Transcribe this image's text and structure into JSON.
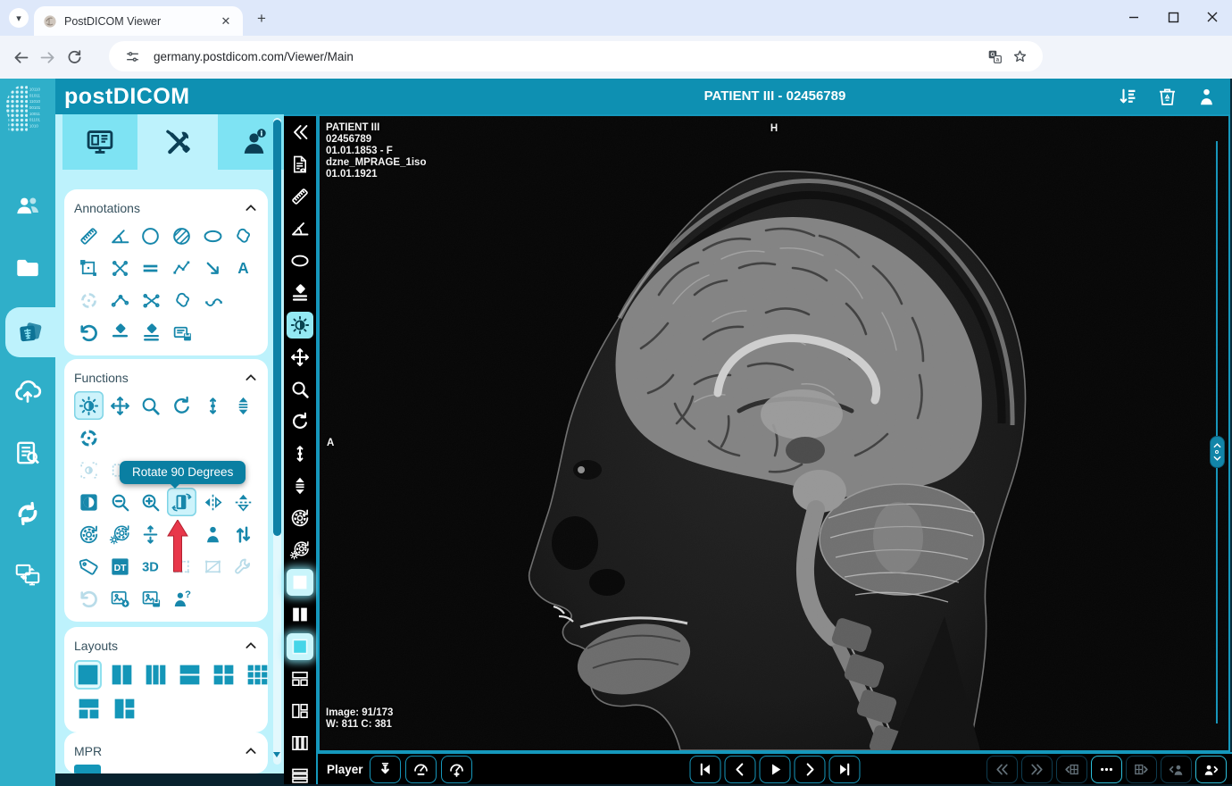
{
  "browser": {
    "tab_title": "PostDICOM Viewer",
    "url": "germany.postdicom.com/Viewer/Main"
  },
  "header": {
    "logo_post": "post",
    "logo_dicom": "DICOM",
    "title": "PATIENT III - 02456789",
    "icons": [
      {
        "name": "sort-queue-icon",
        "sym": "s-sortdown",
        "inter": "true"
      },
      {
        "name": "recycle-bin-icon",
        "sym": "s-trash",
        "inter": "true"
      },
      {
        "name": "account-icon",
        "sym": "s-person",
        "inter": "true"
      }
    ]
  },
  "sidebar": {
    "items": [
      {
        "name": "sidebar-item-patient-search",
        "sym": "s-users",
        "st": "",
        "inter": "true"
      },
      {
        "name": "sidebar-item-folders",
        "sym": "s-folder",
        "st": "",
        "inter": "true"
      },
      {
        "name": "sidebar-item-viewer",
        "sym": "s-xray",
        "st": "active",
        "inter": "true"
      },
      {
        "name": "sidebar-item-upload",
        "sym": "s-cloudup",
        "st": "",
        "inter": "true"
      },
      {
        "name": "sidebar-item-order-worklist",
        "sym": "s-listsearch",
        "st": "",
        "inter": "true"
      },
      {
        "name": "sidebar-item-dicom-transfer",
        "sym": "s-sync",
        "st": "",
        "inter": "true"
      },
      {
        "name": "sidebar-item-remote-viewing",
        "sym": "s-screens",
        "st": "",
        "inter": "true"
      }
    ]
  },
  "panel": {
    "tabs": [
      {
        "name": "tab-study-content",
        "sym": "s-monitor",
        "st": "",
        "inter": "true"
      },
      {
        "name": "tab-tools",
        "sym": "s-tools",
        "st": "selected",
        "inter": "true"
      },
      {
        "name": "tab-patient-info",
        "sym": "s-personinfo",
        "st": "",
        "inter": "true"
      }
    ],
    "tooltip": "Rotate 90 Degrees",
    "annotations": {
      "title": "Annotations",
      "r1": [
        {
          "name": "measure-length-tool",
          "sym": "s-ruler",
          "st": "",
          "inter": "true"
        },
        {
          "name": "measure-angle-tool",
          "sym": "s-angle",
          "st": "",
          "inter": "true"
        },
        {
          "name": "circle-roi-tool",
          "sym": "s-circle",
          "st": "",
          "inter": "true"
        },
        {
          "name": "filled-circle-roi-tool",
          "sym": "s-circlehatch",
          "st": "",
          "inter": "true"
        },
        {
          "name": "ellipse-roi-tool",
          "sym": "s-ellipse",
          "st": "",
          "inter": "true"
        },
        {
          "name": "freehand-roi-tool",
          "sym": "s-blob",
          "st": "",
          "inter": "true"
        }
      ],
      "r2": [
        {
          "name": "rectangle-roi-tool",
          "sym": "s-rectroi",
          "st": "",
          "inter": "true"
        },
        {
          "name": "cross-measurement-tool",
          "sym": "s-crossx",
          "st": "",
          "inter": "true"
        },
        {
          "name": "parallel-lines-tool",
          "sym": "s-parallel",
          "st": "",
          "inter": "true"
        },
        {
          "name": "polyline-tool",
          "sym": "s-polyline",
          "st": "",
          "inter": "true"
        },
        {
          "name": "arrow-annotation-tool",
          "sym": "s-arrowse",
          "st": "",
          "inter": "true"
        },
        {
          "name": "text-annotation-tool",
          "sym": "s-texta",
          "st": "",
          "inter": "true"
        }
      ],
      "r3": [
        {
          "name": "localizer-point-tool",
          "sym": "s-target",
          "st": "disabled",
          "inter": "false"
        },
        {
          "name": "open-angle-tool",
          "sym": "s-anglenodes",
          "st": "",
          "inter": "true"
        },
        {
          "name": "cobb-angle-tool",
          "sym": "s-xnodes",
          "st": "",
          "inter": "true"
        },
        {
          "name": "closed-freehand-tool",
          "sym": "s-blob",
          "st": "",
          "inter": "true"
        },
        {
          "name": "spline-curve-tool",
          "sym": "s-spline",
          "st": "",
          "inter": "true"
        }
      ],
      "r4": [
        {
          "name": "undo-annotation-button",
          "sym": "s-undo",
          "st": "",
          "inter": "true"
        },
        {
          "name": "erase-annotation-button",
          "sym": "s-eraser",
          "st": "",
          "inter": "true"
        },
        {
          "name": "erase-all-annotations-button",
          "sym": "s-eraserline",
          "st": "",
          "inter": "true"
        },
        {
          "name": "save-annotations-button",
          "sym": "s-savenote",
          "st": "",
          "inter": "true"
        }
      ]
    },
    "functions": {
      "title": "Functions",
      "r1": [
        {
          "name": "window-level-tool",
          "sym": "s-brightness",
          "st": "selected",
          "inter": "true"
        },
        {
          "name": "pan-tool",
          "sym": "s-pan",
          "st": "",
          "inter": "true"
        },
        {
          "name": "zoom-tool",
          "sym": "s-magnify",
          "st": "",
          "inter": "true"
        },
        {
          "name": "free-rotate-tool",
          "sym": "s-rotate",
          "st": "",
          "inter": "true"
        },
        {
          "name": "scroll-images-tool",
          "sym": "s-scrollv",
          "st": "",
          "inter": "true"
        },
        {
          "name": "stack-scroll-tool",
          "sym": "s-stack",
          "st": "",
          "inter": "true"
        }
      ],
      "r2": [
        {
          "name": "localizer-tool",
          "sym": "s-localizer",
          "st": "",
          "inter": "true"
        }
      ],
      "r3": [
        {
          "name": "window-level-region-tool",
          "sym": "s-brightregion",
          "st": "disabled",
          "inter": "false"
        },
        {
          "name": "magnify-region-tool",
          "sym": "s-magregion",
          "st": "disabled",
          "inter": "false"
        }
      ],
      "r4": [
        {
          "name": "invert-button",
          "sym": "s-invert",
          "st": "",
          "inter": "true"
        },
        {
          "name": "zoom-out-button",
          "sym": "s-magminus",
          "st": "",
          "inter": "true"
        },
        {
          "name": "zoom-in-button",
          "sym": "s-magplus",
          "st": "",
          "inter": "true"
        },
        {
          "name": "rotate-90-button",
          "sym": "s-rotate90",
          "st": "selected",
          "inter": "true"
        },
        {
          "name": "flip-horizontal-button",
          "sym": "s-fliph",
          "st": "",
          "inter": "true"
        },
        {
          "name": "flip-vertical-button",
          "sym": "s-flipv",
          "st": "",
          "inter": "true"
        }
      ],
      "r5": [
        {
          "name": "reset-rotation-button",
          "sym": "s-gearreset",
          "st": "",
          "inter": "true"
        },
        {
          "name": "reset-window-level-button",
          "sym": "s-gearbright",
          "st": "",
          "inter": "true"
        },
        {
          "name": "fit-vertical-button",
          "sym": "s-expandv",
          "st": "",
          "inter": "true"
        },
        {
          "name": "obscured-tool",
          "sym": "s-rotate",
          "st": "empty",
          "inter": "false"
        },
        {
          "name": "patient-orientation-button",
          "sym": "s-person",
          "st": "",
          "inter": "true"
        },
        {
          "name": "sort-images-button",
          "sym": "s-updown",
          "st": "",
          "inter": "true"
        }
      ],
      "r6": [
        {
          "name": "show-dicom-tags-button",
          "sym": "s-tag",
          "st": "",
          "inter": "true"
        },
        {
          "name": "dt-report-button",
          "sym": "s-dt",
          "st": "",
          "inter": "true"
        },
        {
          "name": "open-3d-button",
          "sym": "s-3d",
          "st": "",
          "inter": "true"
        },
        {
          "name": "select-region-tool",
          "sym": "s-rectdashed",
          "st": "disabled",
          "inter": "false"
        },
        {
          "name": "crop-region-tool",
          "sym": "s-rectcross",
          "st": "disabled",
          "inter": "false"
        },
        {
          "name": "repair-image-tool",
          "sym": "s-wrench",
          "st": "disabled",
          "inter": "false"
        }
      ],
      "r7": [
        {
          "name": "soft-undo-button",
          "sym": "s-undo",
          "st": "disabled",
          "inter": "false"
        },
        {
          "name": "export-image-button",
          "sym": "s-imgexport",
          "st": "",
          "inter": "true"
        },
        {
          "name": "save-image-button",
          "sym": "s-imgsave",
          "st": "",
          "inter": "true"
        },
        {
          "name": "assign-patient-button",
          "sym": "s-personq",
          "st": "",
          "inter": "true"
        }
      ]
    },
    "layouts": {
      "title": "Layouts",
      "r1": [
        {
          "name": "layout-1x1",
          "sym": "s-lay1",
          "st": "selected",
          "inter": "true"
        },
        {
          "name": "layout-1x2",
          "sym": "s-lay2col",
          "st": "",
          "inter": "true"
        },
        {
          "name": "layout-1x3",
          "sym": "s-lay3col",
          "st": "",
          "inter": "true"
        },
        {
          "name": "layout-2x1",
          "sym": "s-lay2row",
          "st": "",
          "inter": "true"
        },
        {
          "name": "layout-2x2",
          "sym": "s-lay22",
          "st": "",
          "inter": "true"
        },
        {
          "name": "layout-3x3",
          "sym": "s-lay33",
          "st": "",
          "inter": "true"
        }
      ],
      "r2": [
        {
          "name": "layout-1-top-2-bottom",
          "sym": "s-lay12b",
          "st": "",
          "inter": "true"
        },
        {
          "name": "layout-1-left-2-right",
          "sym": "s-lay12r",
          "st": "",
          "inter": "true"
        }
      ]
    },
    "mpr": {
      "title": "MPR"
    }
  },
  "toolbar": {
    "items": [
      {
        "name": "collapse-panel-button",
        "sym": "s-chevleft2",
        "st": "",
        "inter": "true"
      },
      {
        "name": "report-button",
        "sym": "s-report",
        "st": "",
        "inter": "true"
      },
      {
        "name": "measure-length-tool",
        "sym": "s-ruler",
        "st": "",
        "inter": "true"
      },
      {
        "name": "measure-angle-tool",
        "sym": "s-angle",
        "st": "",
        "inter": "true"
      },
      {
        "name": "ellipse-roi-tool",
        "sym": "s-ellipse",
        "st": "",
        "inter": "true"
      },
      {
        "name": "erase-annotation-button",
        "sym": "s-eraserline",
        "st": "",
        "inter": "true"
      },
      {
        "name": "window-level-tool",
        "sym": "s-brightness",
        "st": "selected",
        "inter": "true"
      },
      {
        "name": "pan-tool",
        "sym": "s-pan",
        "st": "",
        "inter": "true"
      },
      {
        "name": "zoom-tool",
        "sym": "s-magnify",
        "st": "",
        "inter": "true"
      },
      {
        "name": "free-rotate-tool",
        "sym": "s-rotate",
        "st": "",
        "inter": "true"
      },
      {
        "name": "scroll-images-tool",
        "sym": "s-scrollv",
        "st": "",
        "inter": "true"
      },
      {
        "name": "stack-scroll-tool",
        "sym": "s-stack",
        "st": "",
        "inter": "true"
      },
      {
        "name": "reset-rotation-button",
        "sym": "s-gearreset",
        "st": "",
        "inter": "true"
      },
      {
        "name": "reset-window-level-button",
        "sym": "s-gearbright",
        "st": "",
        "inter": "true"
      },
      {
        "name": "single-image-layout-button",
        "sym": "s-win1",
        "st": "glow",
        "inter": "true"
      },
      {
        "name": "two-column-layout-button",
        "sym": "s-win2col",
        "st": "",
        "inter": "true"
      },
      {
        "name": "single-series-layout-button",
        "sym": "s-wincyan",
        "st": "glow",
        "inter": "true"
      },
      {
        "name": "layout-top-two-button",
        "sym": "s-wintop2",
        "st": "",
        "inter": "true"
      },
      {
        "name": "layout-left-two-button",
        "sym": "s-winleft2",
        "st": "",
        "inter": "true"
      },
      {
        "name": "layout-three-column-button",
        "sym": "s-win3col",
        "st": "",
        "inter": "true"
      },
      {
        "name": "layout-rows-button",
        "sym": "s-winrows",
        "st": "",
        "inter": "true"
      }
    ]
  },
  "viewport": {
    "patient_lines": [
      "PATIENT III",
      "02456789",
      "01.01.1853 - F",
      "dzne_MPRAGE_1iso",
      "01.01.1921"
    ],
    "orientation_top": "H",
    "orientation_left": "A",
    "image_counter": "Image: 91/173",
    "window_level": "W: 811 C: 381"
  },
  "player": {
    "label": "Player",
    "left": [
      {
        "name": "export-video-button",
        "sym": "s-download",
        "st": "",
        "inter": "true"
      },
      {
        "name": "decrease-speed-button",
        "sym": "s-gaugeminus",
        "st": "",
        "inter": "true"
      },
      {
        "name": "increase-speed-button",
        "sym": "s-gaugeplus",
        "st": "",
        "inter": "true"
      }
    ],
    "center": [
      {
        "name": "first-image-button",
        "sym": "s-skipfirst",
        "st": "",
        "inter": "true"
      },
      {
        "name": "previous-image-button",
        "sym": "s-chevleft",
        "st": "",
        "inter": "true"
      },
      {
        "name": "play-button",
        "sym": "s-play",
        "st": "",
        "inter": "true"
      },
      {
        "name": "next-image-button",
        "sym": "s-chevright",
        "st": "",
        "inter": "true"
      },
      {
        "name": "last-image-button",
        "sym": "s-skiplast",
        "st": "",
        "inter": "true"
      }
    ],
    "right": [
      {
        "name": "previous-series-fast-button",
        "sym": "s-dblleft",
        "st": "disabled",
        "inter": "false"
      },
      {
        "name": "next-series-fast-button",
        "sym": "s-dblright",
        "st": "disabled",
        "inter": "false"
      },
      {
        "name": "previous-series-layout-button",
        "sym": "s-gridleft",
        "st": "disabled",
        "inter": "false"
      },
      {
        "name": "series-options-button",
        "sym": "s-dots",
        "st": "active",
        "inter": "true"
      },
      {
        "name": "next-series-layout-button",
        "sym": "s-gridright",
        "st": "disabled",
        "inter": "false"
      },
      {
        "name": "previous-patient-button",
        "sym": "s-personleft",
        "st": "disabled",
        "inter": "false"
      },
      {
        "name": "next-patient-button",
        "sym": "s-personright",
        "st": "active",
        "inter": "true"
      }
    ]
  }
}
